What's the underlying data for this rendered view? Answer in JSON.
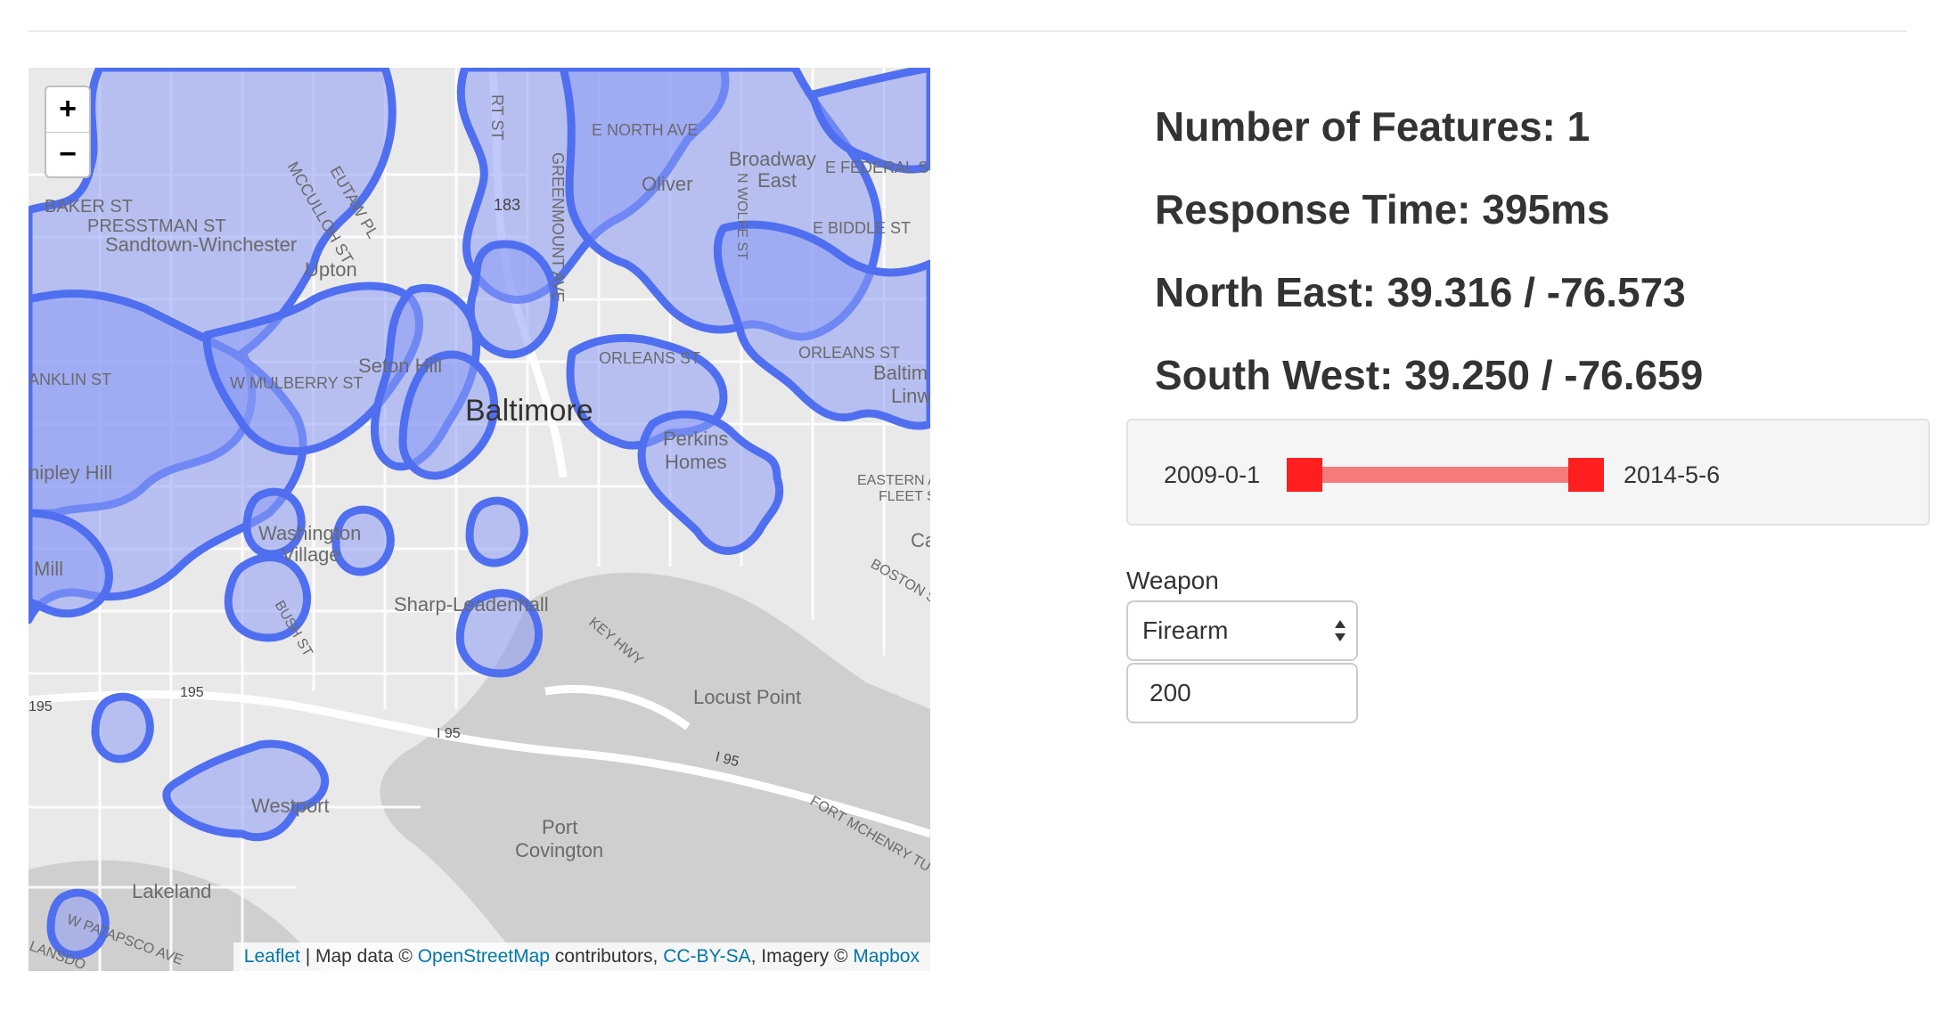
{
  "map": {
    "zoom_in_label": "+",
    "zoom_out_label": "−",
    "labels": {
      "city": "Baltimore",
      "baker": "BAKER ST",
      "presstman": "PRESSTMAN ST",
      "sandtown": "Sandtown-Winchester",
      "upton": "Upton",
      "mcculloh": "MCCULLOH ST",
      "eutaw": "EUTAW PL",
      "n183": "183",
      "greenmount": "GREENMOUNT AVE",
      "enorth": "E NORTH AVE",
      "oliver": "Oliver",
      "broadway": "Broadway",
      "east": "East",
      "nwolfe": "N WOLFE ST",
      "efederal": "E FEDERAL ST",
      "ebiddle": "E BIDDLE ST",
      "setonhill": "Seton Hill",
      "wmulberry": "W MULBERRY ST",
      "franklin": "ANKLIN ST",
      "orleans1": "ORLEANS ST",
      "orleans2": "ORLEANS ST",
      "perkins": "Perkins",
      "homes": "Homes",
      "baltimore_linwood1": "Baltim",
      "baltimore_linwood2": "Linw",
      "shipley": "nipley Hill",
      "millhill": "Mill",
      "washington1": "Washington",
      "washington2": "Village",
      "bush": "BUSH ST",
      "sharp": "Sharp-Leadenhall",
      "keyhwy": "KEY HWY",
      "easternave": "EASTERN A",
      "fleetst": "FLEET S",
      "boston": "BOSTON S",
      "can": "Ca",
      "i195a": "195",
      "i195b": "195",
      "i195c": "I 95",
      "i195d": "I 95",
      "locust": "Locust Point",
      "westport": "Westport",
      "port": "Port",
      "covington": "Covington",
      "fortmchenry": "FORT MCHENRY TU",
      "lakeland": "Lakeland",
      "patapsco": "W PATAPSCO AVE",
      "lansdo": "LANSDO",
      "hs": "RT ST"
    },
    "attribution": {
      "leaflet": "Leaflet",
      "sep": " | Map data © ",
      "osm": "OpenStreetMap",
      "contributors": " contributors, ",
      "ccbysa": "CC-BY-SA",
      "imagery": ", Imagery © ",
      "mapbox": "Mapbox"
    },
    "colors": {
      "overlay_fill": "#8c9cf5",
      "overlay_stroke": "#4f6ff0",
      "road": "#ffffff",
      "water": "#cfcfcf"
    }
  },
  "stats": {
    "features": "Number of Features: 1",
    "response": "Response Time: 395ms",
    "north_east": "North East: 39.316 / -76.573",
    "south_west": "South West: 39.250 / -76.659"
  },
  "date_range": {
    "min_label": "2009-0-1",
    "max_label": "2014-5-6",
    "slider_fraction": [
      0,
      1
    ],
    "colors": {
      "handle": "#ff1f1f",
      "track": "#f57a7a"
    }
  },
  "filters": {
    "weapon_label": "Weapon",
    "weapon_value": "Firearm",
    "count_value": "200"
  }
}
